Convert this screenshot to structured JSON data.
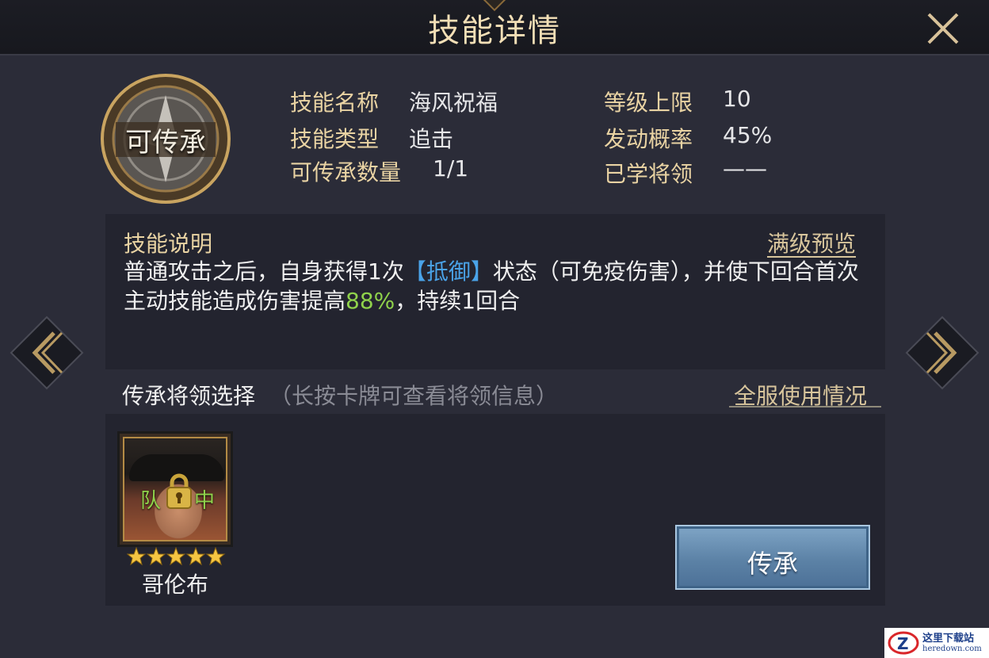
{
  "header": {
    "title": "技能详情"
  },
  "skill": {
    "emblem_label": "可传承",
    "name_label": "技能名称",
    "name_value": "海风祝福",
    "type_label": "技能类型",
    "type_value": "追击",
    "count_label": "可传承数量",
    "count_value": "1/1",
    "level_cap_label": "等级上限",
    "level_cap_value": "10",
    "rate_label": "发动概率",
    "rate_value": "45%",
    "learned_label": "已学将领",
    "learned_value": "——"
  },
  "description": {
    "title": "技能说明",
    "preview_link": "满级预览",
    "text_part1": "普通攻击之后，自身获得1次",
    "keyword": "【抵御】",
    "text_part2": "状态（可免疫伤害），并使下回合首次主动技能造成伤害提高",
    "highlight_value": "88%",
    "text_part3": "，持续1回合"
  },
  "selection": {
    "label": "传承将领选择",
    "hint": "（长按卡牌可查看将领信息）",
    "usage_link": "全服使用情况"
  },
  "hero": {
    "name": "哥伦布",
    "stars": 5,
    "team_tag_left": "队",
    "team_tag_right": "中",
    "locked": true
  },
  "actions": {
    "inherit_button": "传承"
  },
  "watermark": {
    "text": "这里下载站",
    "sub": "heredown.com"
  },
  "colors": {
    "gold_label": "#e9d3a3",
    "keyword_blue": "#4aa3e8",
    "value_green": "#8fd24b",
    "title_gold": "#f3dfb6"
  }
}
